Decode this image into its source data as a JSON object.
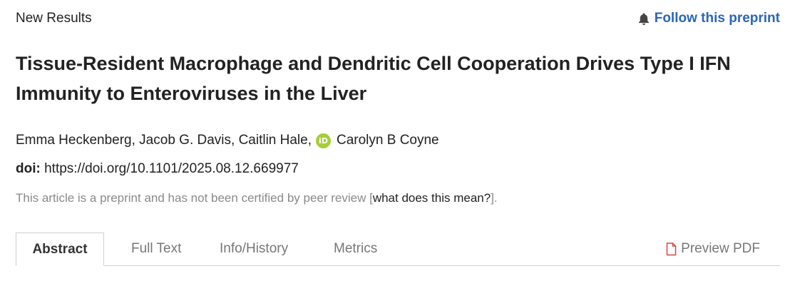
{
  "header": {
    "section_label": "New Results",
    "follow_label": "Follow this preprint",
    "follow_icon": "bell-icon"
  },
  "article": {
    "title": "Tissue-Resident Macrophage and Dendritic Cell Cooperation Drives Type I IFN Immunity to Enteroviruses in the Liver",
    "authors": {
      "part1": "Emma Heckenberg, Jacob G. Davis, Caitlin Hale,",
      "orcid_icon": "orcid-icon",
      "orcid_glyph": "iD",
      "part2": "Carolyn B Coyne"
    },
    "doi_label": "doi:",
    "doi_url": "https://doi.org/10.1101/2025.08.12.669977",
    "preprint_note_before": "This article is a preprint and has not been certified by peer review [",
    "preprint_note_link": "what does this mean?",
    "preprint_note_after": "]."
  },
  "tabs": [
    {
      "label": "Abstract",
      "active": true
    },
    {
      "label": "Full Text",
      "active": false
    },
    {
      "label": "Info/History",
      "active": false
    },
    {
      "label": "Metrics",
      "active": false
    }
  ],
  "preview_pdf": {
    "label": "Preview PDF",
    "icon": "pdf-file-icon"
  },
  "colors": {
    "link_blue": "#2a66b8",
    "orcid_green": "#a6ce39",
    "pdf_icon_red": "#d9473a",
    "muted_text": "#8a8a8a"
  }
}
